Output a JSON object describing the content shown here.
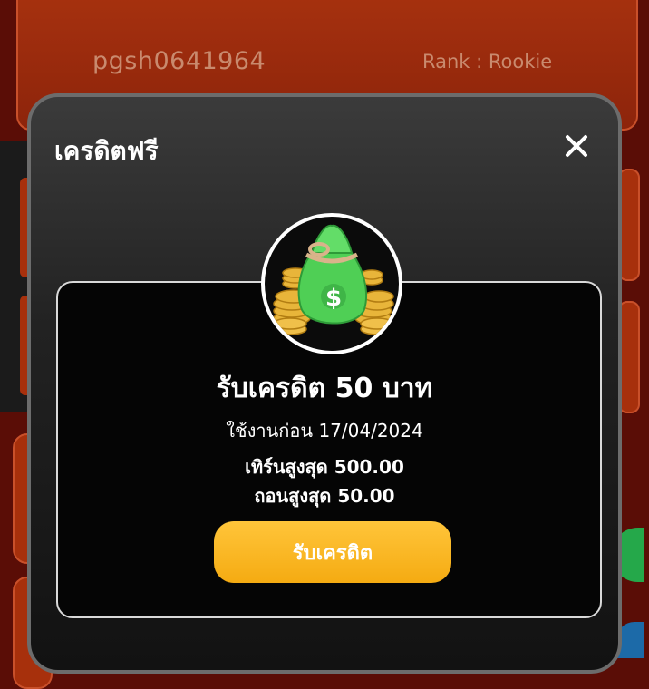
{
  "background": {
    "username": "pgsh0641964",
    "rank_label": "Rank : Rookie"
  },
  "modal": {
    "title": "เครดิตฟรี",
    "close_icon": "close-icon",
    "badge_icon": "money-bag-icon",
    "credit_title": "รับเครดิต 50 บาท",
    "use_before_label": "ใช้งานก่อน",
    "use_before_date": "17/04/2024",
    "max_turnover_label": "เทิร์นสูงสุด",
    "max_turnover_value": "500.00",
    "max_withdraw_label": "ถอนสูงสุด",
    "max_withdraw_value": "50.00",
    "claim_button": "รับเครดิต"
  },
  "colors": {
    "accent": "#f5ab12",
    "background": "#5a0d06",
    "card_bg": "#a7300c"
  }
}
